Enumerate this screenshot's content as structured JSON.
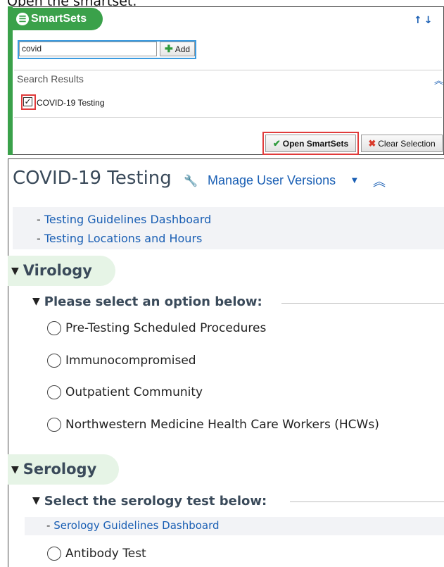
{
  "caption": "Open the smartset.",
  "smartsets_panel": {
    "tab_label": "SmartSets",
    "search_value": "covid",
    "add_label": "Add",
    "search_results_label": "Search Results",
    "result_item": "COVID-19 Testing",
    "open_label": "Open SmartSets",
    "clear_label": "Clear Selection"
  },
  "order_panel": {
    "title": "COVID-19 Testing",
    "manage_label": "Manage User Versions",
    "links": [
      "Testing Guidelines Dashboard",
      "Testing Locations and Hours"
    ],
    "virology": {
      "title": "Virology",
      "prompt": "Please select an option below:",
      "options": [
        "Pre-Testing Scheduled Procedures",
        "Immunocompromised",
        "Outpatient Community",
        "Northwestern Medicine Health Care Workers (HCWs)"
      ]
    },
    "serology": {
      "title": "Serology",
      "prompt": "Select the serology test below:",
      "link": "Serology Guidelines Dashboard",
      "options": [
        "Antibody Test"
      ]
    }
  },
  "colors": {
    "smartsets_green": "#3aa14a",
    "link_blue": "#1a5fb4",
    "highlight_red": "#e03b3b"
  }
}
